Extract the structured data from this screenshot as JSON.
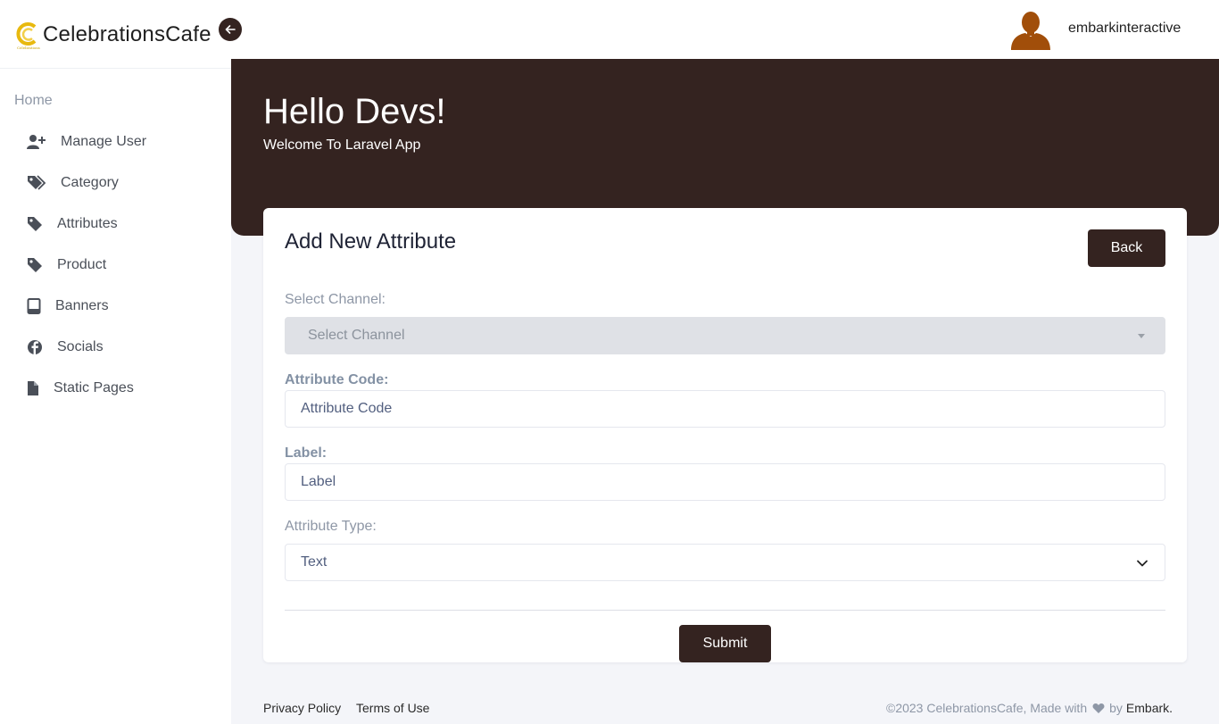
{
  "brand": {
    "name": "CelebrationsCafe",
    "logo_icon": "celebrationscafe-logo",
    "accent": "#e8b90f"
  },
  "colors": {
    "primary": "#342320",
    "sidebar_text": "#4a4f58",
    "muted": "#8e97a6"
  },
  "sidebar": {
    "home_label": "Home",
    "items": [
      {
        "label": "Manage User",
        "icon": "user-plus-icon"
      },
      {
        "label": "Category",
        "icon": "tags-icon"
      },
      {
        "label": "Attributes",
        "icon": "tag-icon"
      },
      {
        "label": "Product",
        "icon": "tag-icon"
      },
      {
        "label": "Banners",
        "icon": "tablet-icon"
      },
      {
        "label": "Socials",
        "icon": "facebook-icon"
      },
      {
        "label": "Static Pages",
        "icon": "file-icon"
      }
    ]
  },
  "topbar": {
    "username": "embarkinteractive",
    "avatar_icon": "user-avatar"
  },
  "hero": {
    "title": "Hello Devs!",
    "subtitle": "Welcome To Laravel App"
  },
  "form": {
    "title": "Add New Attribute",
    "back_label": "Back",
    "channel": {
      "label": "Select Channel:",
      "placeholder": "Select Channel"
    },
    "code": {
      "label": "Attribute Code:",
      "placeholder": "Attribute Code"
    },
    "label_field": {
      "label": "Label:",
      "placeholder": "Label"
    },
    "type": {
      "label": "Attribute Type:",
      "value": "Text"
    },
    "submit_label": "Submit"
  },
  "footer": {
    "privacy": "Privacy Policy",
    "terms": "Terms of Use",
    "copyright_prefix": "©2023 CelebrationsCafe, Made with",
    "copyright_by": "by",
    "company": "Embark."
  }
}
